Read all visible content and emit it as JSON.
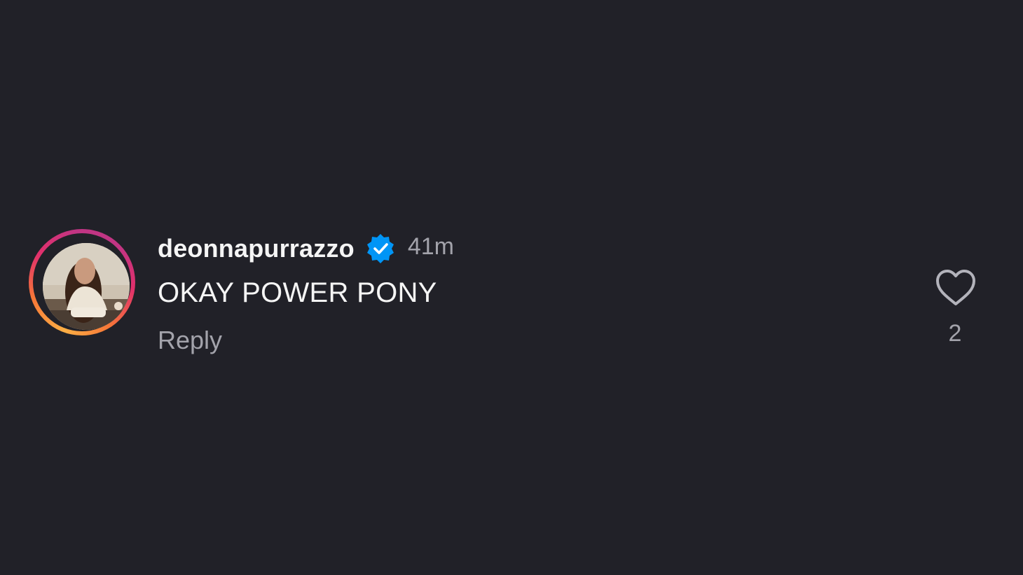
{
  "comment": {
    "username": "deonnapurrazzo",
    "verified": true,
    "verified_icon": "verified-badge-icon",
    "timestamp": "41m",
    "text": "OKAY POWER PONY",
    "reply_label": "Reply",
    "like_icon": "heart-outline-icon",
    "like_count": "2",
    "avatar_ring": "story-gradient-ring"
  },
  "colors": {
    "background": "#212128",
    "primary_text": "#f5f5f5",
    "secondary_text": "#a3a3ab",
    "verified_blue": "#0095f6",
    "ring_gradient": [
      "#fcaf45",
      "#f77737",
      "#e1306c",
      "#c13584"
    ]
  }
}
